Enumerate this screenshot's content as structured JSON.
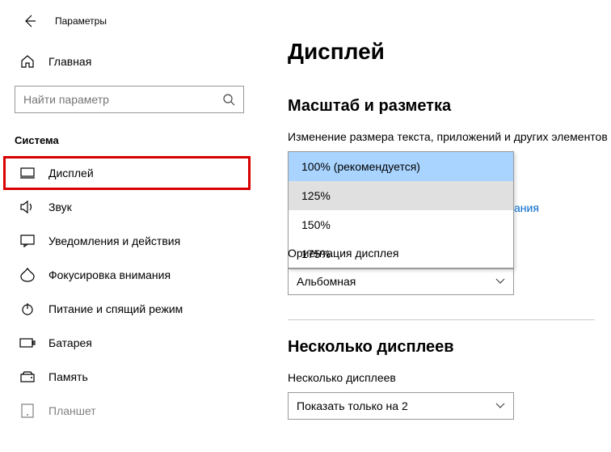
{
  "app": {
    "title": "Параметры"
  },
  "sidebar": {
    "home": "Главная",
    "search_placeholder": "Найти параметр",
    "section": "Система",
    "items": [
      {
        "label": "Дисплей"
      },
      {
        "label": "Звук"
      },
      {
        "label": "Уведомления и действия"
      },
      {
        "label": "Фокусировка внимания"
      },
      {
        "label": "Питание и спящий режим"
      },
      {
        "label": "Батарея"
      },
      {
        "label": "Память"
      },
      {
        "label": "Планшет"
      }
    ]
  },
  "main": {
    "title": "Дисплей",
    "scale_heading": "Масштаб и разметка",
    "scale_label": "Изменение размера текста, приложений и других элементов",
    "scale_options": [
      "100% (рекомендуется)",
      "125%",
      "150%",
      "175%"
    ],
    "link_fragment": "ания",
    "orientation_label": "Ориентация дисплея",
    "orientation_value": "Альбомная",
    "multi_heading": "Несколько дисплеев",
    "multi_label": "Несколько дисплеев",
    "multi_value": "Показать только на 2"
  }
}
